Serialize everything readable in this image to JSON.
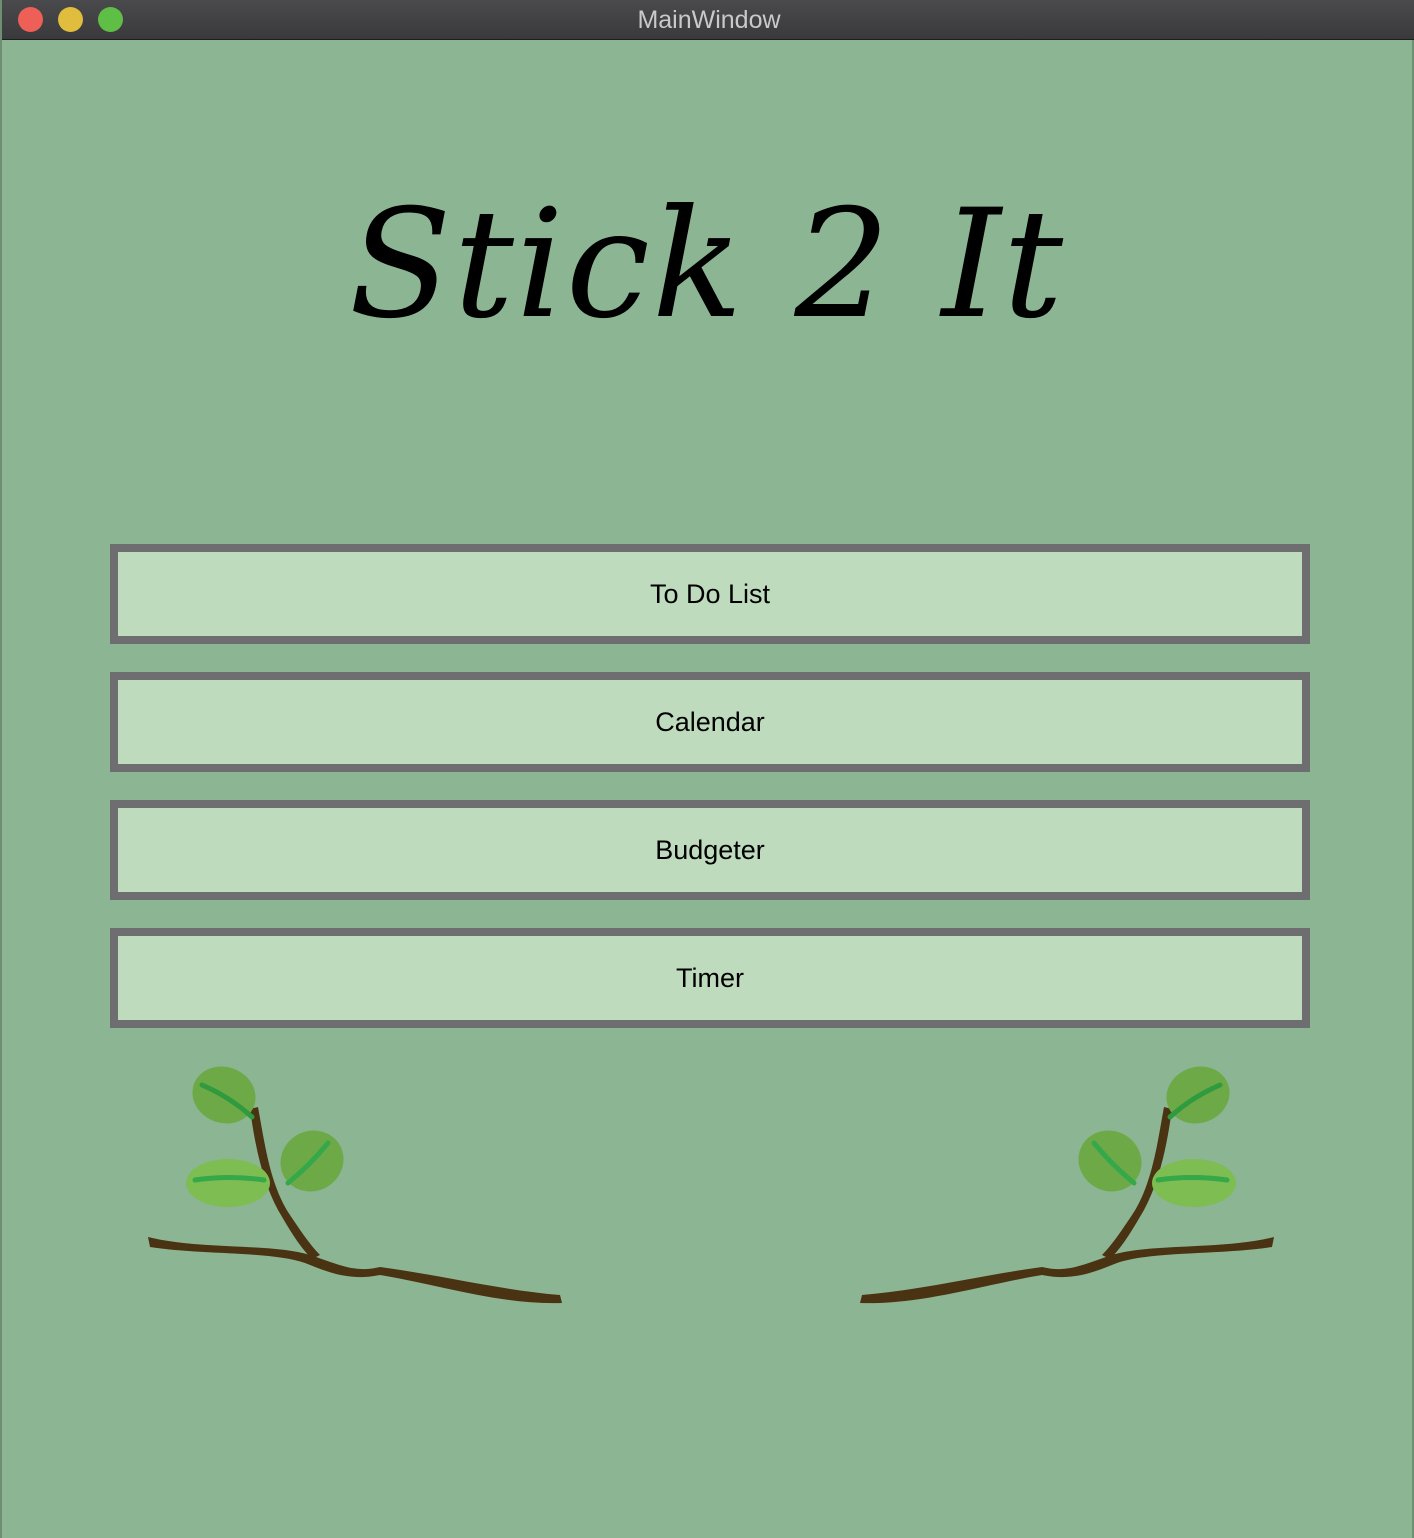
{
  "window": {
    "title": "MainWindow"
  },
  "app": {
    "title": "Stick 2 It"
  },
  "menu": {
    "buttons": [
      {
        "label": "To Do List"
      },
      {
        "label": "Calendar"
      },
      {
        "label": "Budgeter"
      },
      {
        "label": "Timer"
      }
    ]
  },
  "colors": {
    "background": "#8cb594",
    "button_fill": "#bedbbe",
    "button_border": "#6e6e70",
    "leaf_light": "#7dbd52",
    "leaf_vein": "#35a84a",
    "branch": "#4a3312"
  },
  "icons": {
    "left_decoration": "branch-with-leaves-icon",
    "right_decoration": "branch-with-leaves-icon"
  }
}
